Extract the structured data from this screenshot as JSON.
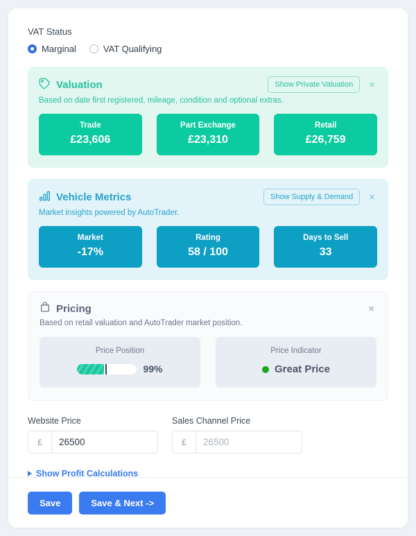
{
  "vat": {
    "label": "VAT Status",
    "options": [
      {
        "label": "Marginal",
        "selected": true
      },
      {
        "label": "VAT Qualifying",
        "selected": false
      }
    ]
  },
  "valuation": {
    "icon": "tag-icon",
    "title": "Valuation",
    "subtitle": "Based on date first registered, mileage, condition and optional extras.",
    "action_label": "Show Private Valuation",
    "close_label": "×",
    "accent": "#0ccba0",
    "background": "#e3f7f1",
    "cards": [
      {
        "label": "Trade",
        "value": "£23,606"
      },
      {
        "label": "Part Exchange",
        "value": "£23,310"
      },
      {
        "label": "Retail",
        "value": "£26,759"
      }
    ]
  },
  "metrics": {
    "icon": "bar-chart-icon",
    "title": "Vehicle Metrics",
    "subtitle": "Market insights powered by AutoTrader.",
    "action_label": "Show Supply & Demand",
    "close_label": "×",
    "accent": "#0d9fc4",
    "background": "#e2f3fa",
    "cards": [
      {
        "label": "Market",
        "value": "-17%"
      },
      {
        "label": "Rating",
        "value": "58 / 100"
      },
      {
        "label": "Days to Sell",
        "value": "33"
      }
    ]
  },
  "pricing": {
    "icon": "bag-icon",
    "title": "Pricing",
    "subtitle": "Based on retail valuation and AutoTrader market position.",
    "close_label": "×",
    "price_position": {
      "label": "Price Position",
      "percent_text": "99%",
      "fill_percent": 45,
      "marker_percent": 47,
      "fill_color": "#18c9a0"
    },
    "price_indicator": {
      "label": "Price Indicator",
      "value": "Great Price",
      "dot_color": "#1aa81a"
    }
  },
  "price_inputs": {
    "website": {
      "label": "Website Price",
      "currency": "£",
      "value": "26500",
      "placeholder": ""
    },
    "sales_channel": {
      "label": "Sales Channel Price",
      "currency": "£",
      "value": "",
      "placeholder": "26500"
    }
  },
  "profit_link": {
    "label": "Show Profit Calculations"
  },
  "footer": {
    "save_label": "Save",
    "save_next_label": "Save & Next ->"
  }
}
